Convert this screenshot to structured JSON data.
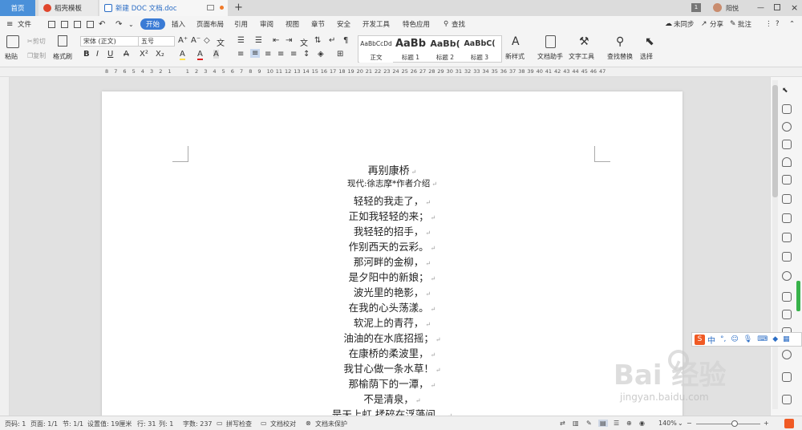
{
  "tabs": {
    "home": "首页",
    "template": "稻壳模板",
    "document": "新建 DOC 文档.doc",
    "add": "+"
  },
  "window": {
    "badge": "1",
    "user": "阳悦"
  },
  "menu": {
    "file": "文件",
    "items": [
      "开始",
      "插入",
      "页面布局",
      "引用",
      "审阅",
      "视图",
      "章节",
      "安全",
      "开发工具",
      "特色应用"
    ],
    "search": "查找",
    "sync": "未同步",
    "share": "分享",
    "comment": "批注"
  },
  "ribbon": {
    "paste": "粘贴",
    "cut": "剪切",
    "copy": "复制",
    "format_painter": "格式刷",
    "font_name": "宋体 (正文)",
    "font_size": "五号",
    "styles": [
      {
        "preview": "AaBbCcDd",
        "label": "正文"
      },
      {
        "preview": "AaBb",
        "label": "标题 1"
      },
      {
        "preview": "AaBb(",
        "label": "标题 2"
      },
      {
        "preview": "AaBbC(",
        "label": "标题 3"
      }
    ],
    "new_style": "新样式",
    "doc_assistant": "文档助手",
    "text_tools": "文字工具",
    "find_replace": "查找替换",
    "select": "选择"
  },
  "ruler": {
    "numbers": [
      "8",
      "7",
      "6",
      "5",
      "4",
      "3",
      "2",
      "1",
      "",
      "1",
      "2",
      "3",
      "4",
      "5",
      "6",
      "7",
      "8",
      "9",
      "10",
      "11",
      "12",
      "13",
      "14",
      "15",
      "16",
      "17",
      "18",
      "19",
      "20",
      "21",
      "22",
      "23",
      "24",
      "25",
      "26",
      "27",
      "28",
      "29",
      "30",
      "31",
      "32",
      "33",
      "34",
      "35",
      "36",
      "37",
      "38",
      "39",
      "40",
      "41",
      "42",
      "43",
      "44",
      "45",
      "46",
      "47"
    ]
  },
  "document": {
    "lines": [
      "再别康桥",
      "现代:徐志摩*作者介绍",
      "轻轻的我走了，",
      "正如我轻轻的来；",
      "我轻轻的招手，",
      "作别西天的云彩。",
      "那河畔的金柳，",
      "是夕阳中的新娘；",
      "波光里的艳影，",
      "在我的心头荡漾。",
      "软泥上的青荇，",
      "油油的在水底招摇；",
      "在康桥的柔波里，",
      "我甘心做一条水草！",
      "那榆荫下的一潭，",
      "不是清泉，",
      "是天上虹  揉碎在浮藻间，"
    ],
    "mark": "↵"
  },
  "ime": {
    "label": "中"
  },
  "watermark": {
    "brand": "Bai  经验",
    "url": "jingyan.baidu.com"
  },
  "status": {
    "page_num": "页码: 1",
    "pages": "页面: 1/1",
    "section": "节: 1/1",
    "position": "设置值: 19厘米",
    "row": "行: 31",
    "col": "列: 1",
    "words": "字数: 237",
    "spell": "拼写检查",
    "proof": "文档校对",
    "protect": "文档未保护",
    "zoom": "140%"
  },
  "colors": {
    "accent": "#3a7bd5",
    "home_tab": "#4a90d9",
    "template_icon": "#e0452b"
  }
}
